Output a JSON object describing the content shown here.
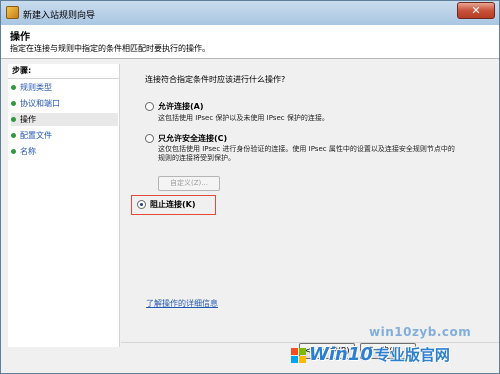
{
  "window": {
    "title": "新建入站规则向导",
    "close_glyph": "✕"
  },
  "header": {
    "title": "操作",
    "description": "指定在连接与规则中指定的条件相匹配时要执行的操作。"
  },
  "steps": {
    "title": "步骤:",
    "items": [
      {
        "label": "规则类型",
        "current": false
      },
      {
        "label": "协议和端口",
        "current": false
      },
      {
        "label": "操作",
        "current": true
      },
      {
        "label": "配置文件",
        "current": false
      },
      {
        "label": "名称",
        "current": false
      }
    ]
  },
  "main": {
    "question": "连接符合指定条件时应该进行什么操作?",
    "options": [
      {
        "label": "允许连接(A)",
        "description": "这包括使用 IPsec 保护以及未使用 IPsec 保护的连接。",
        "checked": false
      },
      {
        "label": "只允许安全连接(C)",
        "description": "这仅包括使用 IPsec 进行身份验证的连接。使用 IPsec 属性中的设置以及连接安全规则节点中的规则的连接将受到保护。",
        "checked": false
      },
      {
        "label": "阻止连接(K)",
        "description": "",
        "checked": true
      }
    ],
    "custom_button": "自定义(Z)...",
    "learn_more_link": "了解操作的详细信息"
  },
  "footer": {
    "back_button": "< 上一步(B)",
    "next_button": "下一步(N) >"
  },
  "watermark": {
    "url": "win10zyb.com",
    "logo_text": "Win10",
    "logo_cn": "专业版官网"
  }
}
